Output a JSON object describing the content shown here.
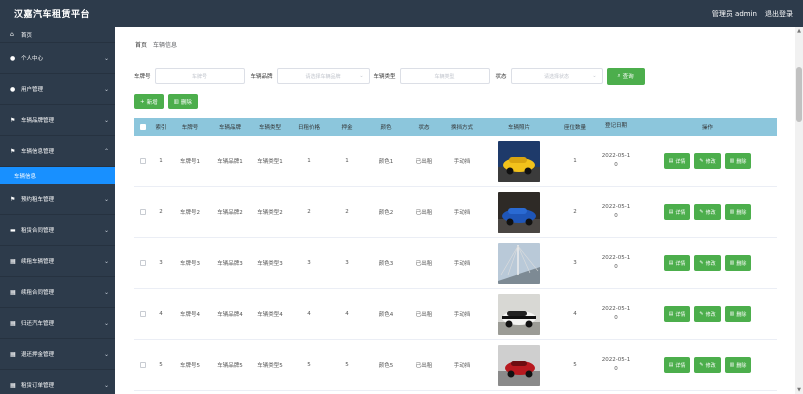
{
  "header": {
    "title": "汉嘉汽车租赁平台",
    "user_label": "管理员 admin",
    "logout_label": "退出登录"
  },
  "sidebar": {
    "items": [
      {
        "label": "首页",
        "icon": "home-icon"
      },
      {
        "label": "个人中心",
        "icon": "user-icon"
      },
      {
        "label": "用户管理",
        "icon": "users-icon"
      },
      {
        "label": "车辆品牌管理",
        "icon": "flag-icon"
      },
      {
        "label": "车辆信息管理",
        "icon": "flag-icon"
      },
      {
        "label": "车辆信息",
        "icon": ""
      },
      {
        "label": "预约租车管理",
        "icon": "flag-icon"
      },
      {
        "label": "租赁合同管理",
        "icon": "card-icon"
      },
      {
        "label": "续租车辆管理",
        "icon": "grid-icon"
      },
      {
        "label": "续租合同管理",
        "icon": "grid-icon"
      },
      {
        "label": "归还汽车管理",
        "icon": "grid-icon"
      },
      {
        "label": "退还押金管理",
        "icon": "grid-icon"
      },
      {
        "label": "租赁订单管理",
        "icon": "grid-icon"
      }
    ]
  },
  "breadcrumb": {
    "home": "首页",
    "current": "车辆信息"
  },
  "filters": {
    "plate_label": "车牌号",
    "plate_placeholder": "车牌号",
    "brand_label": "车辆品牌",
    "brand_placeholder": "请选择车辆品牌",
    "type_label": "车辆类型",
    "type_placeholder": "车辆类型",
    "status_label": "状态",
    "status_placeholder": "请选择状态",
    "search_label": "查询"
  },
  "actions": {
    "add_label": "新增",
    "delete_label": "删除"
  },
  "table": {
    "headers": [
      "索引",
      "车牌号",
      "车辆品牌",
      "车辆类型",
      "日租价格",
      "押金",
      "颜色",
      "状态",
      "换挡方式",
      "车辆照片",
      "座位数量",
      "登记日期",
      "操作"
    ],
    "rows": [
      {
        "index": "1",
        "plate": "车牌号1",
        "brand": "车辆品牌1",
        "type": "车辆类型1",
        "price": "1",
        "deposit": "1",
        "color": "颜色1",
        "status": "已出租",
        "gear": "手动挡",
        "seats": "1",
        "date_a": "2022-05-1",
        "date_b": "0"
      },
      {
        "index": "2",
        "plate": "车牌号2",
        "brand": "车辆品牌2",
        "type": "车辆类型2",
        "price": "2",
        "deposit": "2",
        "color": "颜色2",
        "status": "已出租",
        "gear": "手动挡",
        "seats": "2",
        "date_a": "2022-05-1",
        "date_b": "0"
      },
      {
        "index": "3",
        "plate": "车牌号3",
        "brand": "车辆品牌3",
        "type": "车辆类型3",
        "price": "3",
        "deposit": "3",
        "color": "颜色3",
        "status": "已出租",
        "gear": "手动挡",
        "seats": "3",
        "date_a": "2022-05-1",
        "date_b": "0"
      },
      {
        "index": "4",
        "plate": "车牌号4",
        "brand": "车辆品牌4",
        "type": "车辆类型4",
        "price": "4",
        "deposit": "4",
        "color": "颜色4",
        "status": "已出租",
        "gear": "手动挡",
        "seats": "4",
        "date_a": "2022-05-1",
        "date_b": "0"
      },
      {
        "index": "5",
        "plate": "车牌号5",
        "brand": "车辆品牌5",
        "type": "车辆类型5",
        "price": "5",
        "deposit": "5",
        "color": "颜色5",
        "status": "已出租",
        "gear": "手动挡",
        "seats": "5",
        "date_a": "2022-05-1",
        "date_b": "0"
      }
    ],
    "op_detail": "详情",
    "op_edit": "修改",
    "op_delete": "删除"
  },
  "colors": {
    "sidebar_bg": "#2d3b4b",
    "accent_blue": "#1890ff",
    "button_green": "#4cae4c",
    "table_header": "#8cc6dc"
  }
}
